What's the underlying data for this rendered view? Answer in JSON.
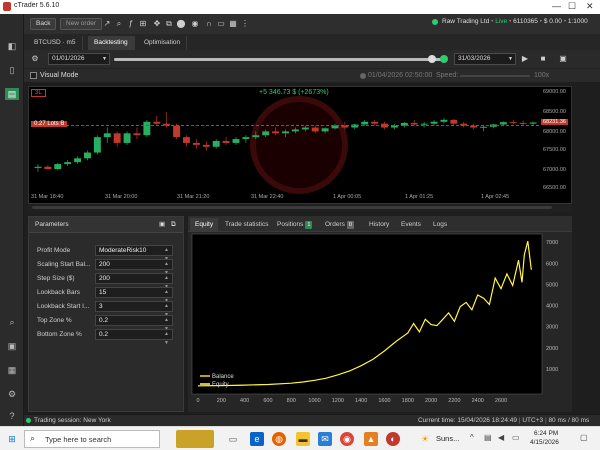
{
  "app": {
    "title": "cTrader 5.6.10",
    "accent": "#2e8b57"
  },
  "toolbar": {
    "back_label": "Back",
    "new_order_label": "New order",
    "account_name": "Raw Trading Ltd",
    "live_label": "Live",
    "account_id": "6110365",
    "balance": "$ 0.00",
    "leverage": "1:1000"
  },
  "tabs": {
    "symbol": "BTCUSD · m5",
    "backtesting": "Backtesting",
    "optimisation": "Optimisation"
  },
  "controls": {
    "start_date": "01/01/2026",
    "end_date": "31/03/2026",
    "visual_mode": "Visual Mode",
    "progress_time": "01/04/2026 02:50:00",
    "speed_label": "Speed:",
    "speed_value": "100x",
    "progress_fraction": 1.0
  },
  "chart": {
    "pnl_label": "+5 346.73 $ (+2673%)",
    "marker_3l": "3L",
    "lots_label": "0.27 Lots B",
    "price_tag": "68231.36",
    "y_ticks": [
      "69000.00",
      "68500.00",
      "68000.00",
      "67500.00",
      "67000.00",
      "66500.00"
    ],
    "x_ticks": [
      "31 Mar 18:40",
      "31 Mar 20:00",
      "31 Mar 21:20",
      "31 Mar 22:40",
      "1 Apr 00:05",
      "1 Apr 01:25",
      "1 Apr 02:45"
    ],
    "candles": [
      [
        67050,
        67150,
        66950,
        67080
      ],
      [
        67080,
        67120,
        67000,
        67020
      ],
      [
        67020,
        67180,
        66990,
        67150
      ],
      [
        67150,
        67250,
        67100,
        67200
      ],
      [
        67200,
        67350,
        67150,
        67300
      ],
      [
        67300,
        67500,
        67250,
        67450
      ],
      [
        67450,
        67900,
        67400,
        67850
      ],
      [
        67850,
        68100,
        67700,
        67950
      ],
      [
        67950,
        68000,
        67600,
        67700
      ],
      [
        67700,
        68000,
        67650,
        67950
      ],
      [
        67950,
        68100,
        67800,
        67900
      ],
      [
        67900,
        68300,
        67850,
        68250
      ],
      [
        68250,
        68400,
        68150,
        68200
      ],
      [
        68200,
        68500,
        68100,
        68150
      ],
      [
        68150,
        68200,
        67800,
        67850
      ],
      [
        67850,
        67900,
        67600,
        67700
      ],
      [
        67700,
        67800,
        67550,
        67650
      ],
      [
        67650,
        67750,
        67500,
        67600
      ],
      [
        67600,
        67800,
        67550,
        67750
      ],
      [
        67750,
        67850,
        67650,
        67700
      ],
      [
        67700,
        67850,
        67650,
        67800
      ],
      [
        67800,
        67900,
        67700,
        67850
      ],
      [
        67850,
        68000,
        67800,
        67900
      ],
      [
        67900,
        68050,
        67850,
        68000
      ],
      [
        68000,
        68100,
        67900,
        67950
      ],
      [
        67950,
        68050,
        67850,
        68000
      ],
      [
        68000,
        68100,
        67950,
        68050
      ],
      [
        68050,
        68150,
        68000,
        68100
      ],
      [
        68100,
        68150,
        67950,
        68000
      ],
      [
        68000,
        68100,
        67950,
        68080
      ],
      [
        68080,
        68200,
        68050,
        68150
      ],
      [
        68150,
        68250,
        68050,
        68100
      ],
      [
        68100,
        68200,
        68050,
        68180
      ],
      [
        68180,
        68300,
        68150,
        68250
      ],
      [
        68250,
        68300,
        68150,
        68200
      ],
      [
        68200,
        68250,
        68050,
        68100
      ],
      [
        68100,
        68200,
        68050,
        68150
      ],
      [
        68150,
        68250,
        68100,
        68220
      ],
      [
        68220,
        68300,
        68150,
        68180
      ],
      [
        68180,
        68250,
        68100,
        68200
      ],
      [
        68200,
        68300,
        68150,
        68250
      ],
      [
        68250,
        68350,
        68200,
        68300
      ],
      [
        68300,
        68320,
        68150,
        68200
      ],
      [
        68200,
        68250,
        68100,
        68150
      ],
      [
        68150,
        68200,
        68050,
        68100
      ],
      [
        68100,
        68150,
        68000,
        68120
      ],
      [
        68120,
        68200,
        68080,
        68180
      ],
      [
        68180,
        68260,
        68150,
        68240
      ],
      [
        68240,
        68300,
        68180,
        68220
      ],
      [
        68220,
        68280,
        68150,
        68200
      ],
      [
        68200,
        68260,
        68160,
        68230
      ]
    ]
  },
  "parameters": {
    "title": "Parameters",
    "rows": [
      {
        "label": "Profit Mode",
        "value": "ModerateRisk10"
      },
      {
        "label": "Scaling Start Bal...",
        "value": "200"
      },
      {
        "label": "Step Size ($)",
        "value": "200"
      },
      {
        "label": "Lookback Bars",
        "value": "15"
      },
      {
        "label": "Lookback Start I...",
        "value": "3"
      },
      {
        "label": "Top Zone %",
        "value": "0.2"
      },
      {
        "label": "Bottom Zone %",
        "value": "0.2"
      }
    ]
  },
  "results_tabs": {
    "equity": "Equity",
    "trade_stats": "Trade statistics",
    "positions": "Positions",
    "positions_count": "1",
    "orders": "Orders",
    "orders_count": "0",
    "history": "History",
    "events": "Events",
    "logs": "Logs"
  },
  "chart_data": {
    "type": "line",
    "xlim": [
      0,
      2900
    ],
    "ylim": [
      0,
      7200
    ],
    "x_ticks": [
      0,
      200,
      400,
      600,
      800,
      1000,
      1200,
      1400,
      1600,
      1800,
      2000,
      2200,
      2400,
      2600
    ],
    "y_ticks": [
      1000,
      2000,
      3000,
      4000,
      5000,
      6000,
      7000
    ],
    "legend_position": "bottom-left",
    "series": [
      {
        "name": "Balance",
        "color": "#ffd700",
        "x": [
          0,
          200,
          400,
          600,
          800,
          900,
          1000,
          1100,
          1200,
          1300,
          1400,
          1500,
          1600,
          1700,
          1800,
          1850,
          1900,
          1950,
          2000,
          2050,
          2100,
          2150,
          2200,
          2250,
          2300,
          2350,
          2400,
          2450,
          2500,
          2550,
          2600,
          2650,
          2700,
          2750,
          2780,
          2800,
          2830,
          2860
        ],
        "values": [
          200,
          210,
          230,
          260,
          320,
          380,
          460,
          560,
          720,
          900,
          1150,
          1450,
          1850,
          2300,
          2700,
          3150,
          2750,
          3350,
          3100,
          3050,
          3350,
          3650,
          3250,
          3950,
          4150,
          3800,
          4500,
          4350,
          4050,
          5300,
          4800,
          5500,
          4950,
          6150,
          5100,
          6400,
          7050,
          5700
        ]
      },
      {
        "name": "Equity",
        "color": "#ffff66",
        "x": [
          0,
          200,
          400,
          600,
          800,
          900,
          1000,
          1100,
          1200,
          1300,
          1400,
          1500,
          1600,
          1700,
          1800,
          1850,
          1900,
          1950,
          2000,
          2050,
          2100,
          2150,
          2200,
          2250,
          2300,
          2350,
          2400,
          2450,
          2500,
          2550,
          2600,
          2650,
          2700,
          2750,
          2780,
          2800,
          2830,
          2860
        ],
        "values": [
          200,
          210,
          230,
          260,
          320,
          380,
          460,
          560,
          720,
          900,
          1150,
          1450,
          1850,
          2300,
          2700,
          3150,
          2750,
          3350,
          3100,
          3050,
          3350,
          3650,
          3250,
          3950,
          4150,
          3800,
          4500,
          4350,
          4050,
          5300,
          4800,
          5500,
          4950,
          6150,
          5100,
          6400,
          7050,
          5700
        ]
      }
    ]
  },
  "status": {
    "session": "Trading session: New York",
    "current_time_label": "Current time:",
    "current_time": "15/04/2026 18:24:49",
    "tz": "UTC+3",
    "latency": "80 ms / 80 ms"
  },
  "taskbar": {
    "search_placeholder": "Type here to search",
    "weather": "Suns...",
    "clock_time": "6:24 PM",
    "clock_date": "4/15/2026"
  }
}
